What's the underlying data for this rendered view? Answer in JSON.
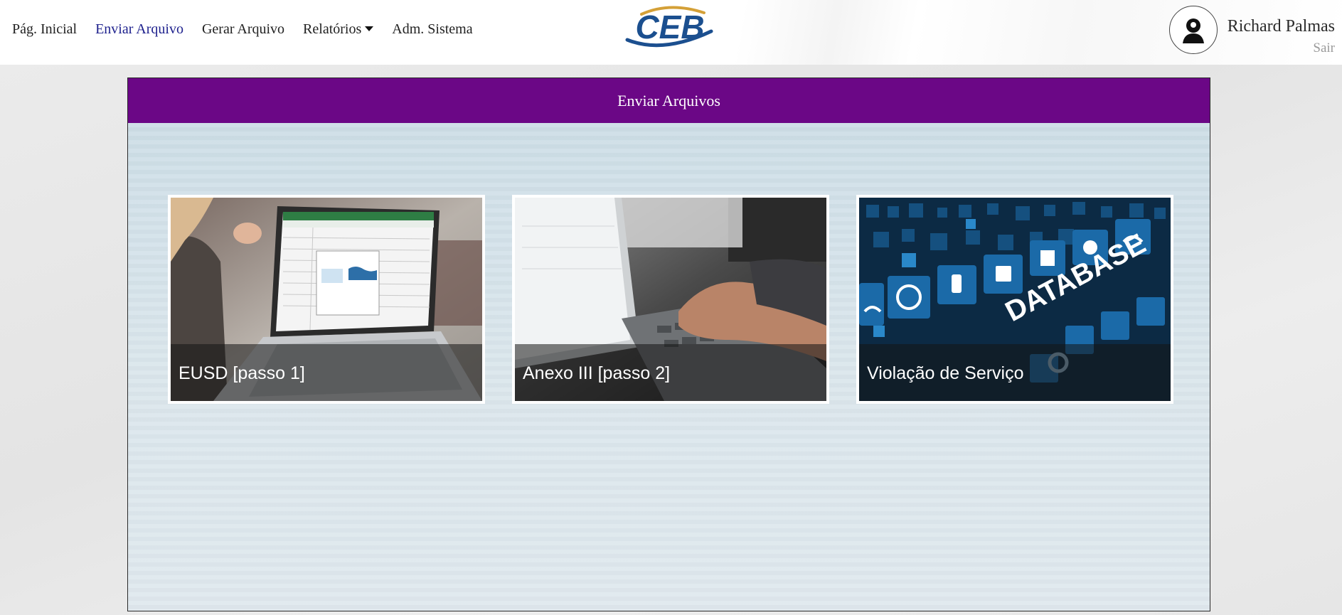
{
  "navbar": {
    "links": [
      {
        "label": "Pág. Inicial",
        "active": false
      },
      {
        "label": "Enviar Arquivo",
        "active": true
      },
      {
        "label": "Gerar Arquivo",
        "active": false
      },
      {
        "label": "Relatórios",
        "active": false,
        "dropdown": true
      },
      {
        "label": "Adm. Sistema",
        "active": false
      }
    ],
    "logo_text": "CEB",
    "user": {
      "name": "Richard Palmas",
      "logout_label": "Sair",
      "avatar_icon": "user-icon"
    }
  },
  "panel": {
    "title": "Enviar Arquivos",
    "cards": [
      {
        "label": "EUSD [passo 1]",
        "image": "laptop-spreadsheet-photo"
      },
      {
        "label": "Anexo III [passo 2]",
        "image": "typing-laptop-photo"
      },
      {
        "label": "Violação de Serviço",
        "image": "database-tiles-photo"
      }
    ]
  },
  "colors": {
    "panel_header": "#6b0786",
    "active_link": "#1c1f8c",
    "logo_blue": "#1b4f8f",
    "logo_gold": "#d4a037"
  }
}
